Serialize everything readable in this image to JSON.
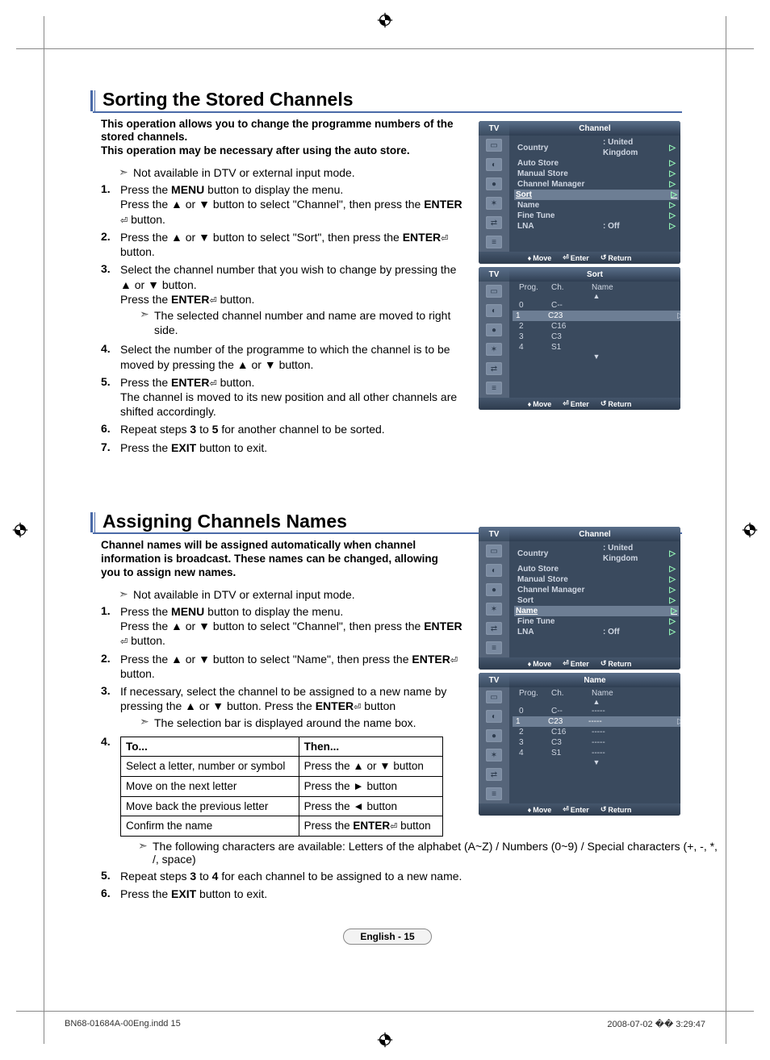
{
  "section1": {
    "title": "Sorting the Stored Channels",
    "intro": "This operation allows you to change the programme numbers of the stored channels.\nThis operation may be necessary after using the auto store.",
    "note": "Not available in DTV or external input mode.",
    "steps": {
      "s1a": "Press the ",
      "s1b": "MENU",
      "s1c": " button to display the menu.",
      "s1d": "Press the ▲ or ▼ button to select \"Channel\", then press the ",
      "s1e": "ENTER",
      "s1f": " button.",
      "s2a": "Press the ▲ or ▼ button to select \"Sort\", then press the ",
      "s2b": "ENTER",
      "s2c": " button.",
      "s3a": "Select the channel number that you wish to change by pressing the ▲ or ▼ button.",
      "s3b": "Press the ",
      "s3c": "ENTER",
      "s3d": " button.",
      "s3note": "The selected channel number and name are moved to right side.",
      "s4": "Select the number of the programme to which the channel is to be moved by pressing the ▲ or ▼ button.",
      "s5a": "Press the ",
      "s5b": "ENTER",
      "s5c": " button.",
      "s5d": "The channel is moved to its new position and all other channels are shifted accordingly.",
      "s6a": "Repeat steps ",
      "s6b": "3",
      "s6c": " to ",
      "s6d": "5",
      "s6e": " for another channel to be sorted.",
      "s7a": "Press the ",
      "s7b": "EXIT",
      "s7c": " button to exit."
    }
  },
  "section2": {
    "title": "Assigning Channels Names",
    "intro": "Channel names will be assigned automatically when channel information is broadcast. These names can be changed, allowing you to assign new names.",
    "note": "Not available in DTV or external input mode.",
    "steps": {
      "s1a": "Press the ",
      "s1b": "MENU",
      "s1c": " button to display the menu.",
      "s1d": "Press the ▲ or ▼ button to select \"Channel\", then press the ",
      "s1e": "ENTER",
      "s1f": " button.",
      "s2a": "Press the ▲ or ▼ button to select \"Name\", then press the ",
      "s2b": "ENTER",
      "s2c": " button.",
      "s3a": "If necessary, select the channel to be assigned to a new name by pressing the ▲ or ▼ button. Press the ",
      "s3b": "ENTER",
      "s3c": " button",
      "s3note": "The selection bar is displayed around the name box.",
      "table_h1": "To...",
      "table_h2": "Then...",
      "t1a": "Select a letter, number or symbol",
      "t1b": "Press the ▲ or ▼ button",
      "t2a": "Move on the next letter",
      "t2b": "Press the ► button",
      "t3a": "Move back the previous letter",
      "t3b": "Press the ◄ button",
      "t4a": "Confirm the name",
      "t4b_a": "Press the ",
      "t4b_b": "ENTER",
      "t4b_c": " button",
      "s4note": "The following characters are available: Letters of the alphabet (A~Z) / Numbers (0~9) / Special characters (+, -, *, /, space)",
      "s5a": "Repeat steps ",
      "s5b": "3",
      "s5c": " to ",
      "s5d": "4",
      "s5e": " for each channel to be assigned to a new name.",
      "s6a": "Press the ",
      "s6b": "EXIT",
      "s6c": " button to exit."
    }
  },
  "osd": {
    "tv": "TV",
    "channel_title": "Channel",
    "sort_title": "Sort",
    "name_title": "Name",
    "items": {
      "country": "Country",
      "country_val": ": United Kingdom",
      "auto_store": "Auto Store",
      "manual_store": "Manual Store",
      "channel_manager": "Channel Manager",
      "sort": "Sort",
      "name": "Name",
      "fine_tune": "Fine Tune",
      "lna": "LNA",
      "lna_val": ": Off"
    },
    "footer": {
      "move": "Move",
      "enter": "Enter",
      "return": "Return"
    },
    "sort_cols": {
      "prog": "Prog.",
      "ch": "Ch.",
      "name": "Name"
    },
    "sort_rows": [
      {
        "p": "0",
        "c": "C--",
        "n": ""
      },
      {
        "p": "1",
        "c": "C23",
        "n": ""
      },
      {
        "p": "2",
        "c": "C16",
        "n": ""
      },
      {
        "p": "3",
        "c": "C3",
        "n": ""
      },
      {
        "p": "4",
        "c": "S1",
        "n": ""
      }
    ],
    "name_rows": [
      {
        "p": "0",
        "c": "C--",
        "n": "-----"
      },
      {
        "p": "1",
        "c": "C23",
        "n": "-----"
      },
      {
        "p": "2",
        "c": "C16",
        "n": "-----"
      },
      {
        "p": "3",
        "c": "C3",
        "n": "-----"
      },
      {
        "p": "4",
        "c": "S1",
        "n": "-----"
      }
    ]
  },
  "page_label": "English - 15",
  "footer_left": "BN68-01684A-00Eng.indd   15",
  "footer_right": "2008-07-02   �� 3:29:47"
}
